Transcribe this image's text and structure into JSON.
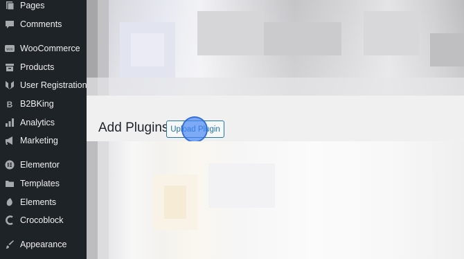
{
  "sidebar": {
    "items": [
      {
        "label": "Pages",
        "icon": "pages-icon"
      },
      {
        "label": "Comments",
        "icon": "comments-icon"
      },
      {
        "label": "WooCommerce",
        "icon": "woocommerce-icon"
      },
      {
        "label": "Products",
        "icon": "products-icon"
      },
      {
        "label": "User Registration",
        "icon": "user-registration-icon"
      },
      {
        "label": "B2BKing",
        "icon": "b2bking-icon"
      },
      {
        "label": "Analytics",
        "icon": "analytics-icon"
      },
      {
        "label": "Marketing",
        "icon": "marketing-icon"
      },
      {
        "label": "Elementor",
        "icon": "elementor-icon"
      },
      {
        "label": "Templates",
        "icon": "templates-icon"
      },
      {
        "label": "Elements",
        "icon": "elements-icon"
      },
      {
        "label": "Crocoblock",
        "icon": "crocoblock-icon"
      },
      {
        "label": "Appearance",
        "icon": "appearance-icon"
      }
    ]
  },
  "header": {
    "title": "Add Plugins",
    "upload_button": "Upload Plugin"
  },
  "colors": {
    "sidebar_bg": "#1d2327",
    "accent": "#2271b1",
    "click_marker": "#4285f4"
  }
}
